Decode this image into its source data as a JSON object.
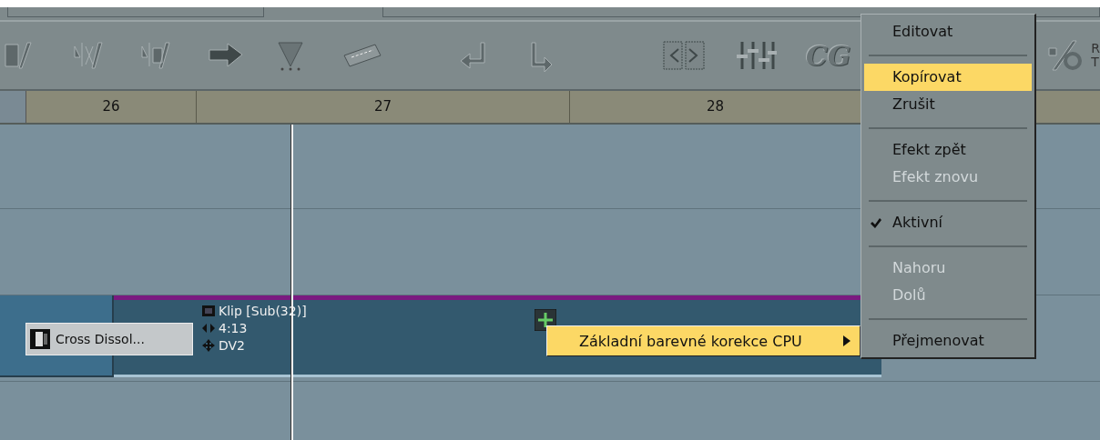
{
  "toolbar": {
    "cg_label": "CG",
    "edge_letters": [
      "R",
      "T"
    ]
  },
  "ruler": {
    "marks": [
      "26",
      "27",
      "28"
    ]
  },
  "timeline": {
    "transition": {
      "label": "Cross Dissol..."
    },
    "clip": {
      "name": "Klip [Sub(32)]",
      "duration": "4:13",
      "format": "DV2"
    }
  },
  "submenu": {
    "label": "Základní barevné korekce CPU",
    "selected": true
  },
  "context_menu": {
    "items": [
      {
        "kind": "item",
        "label": "Editovat",
        "selected": false,
        "disabled": false
      },
      {
        "kind": "separator"
      },
      {
        "kind": "item",
        "label": "Kopírovat",
        "selected": true,
        "disabled": false
      },
      {
        "kind": "item",
        "label": "Zrušit",
        "selected": false,
        "disabled": false
      },
      {
        "kind": "separator"
      },
      {
        "kind": "item",
        "label": "Efekt zpět",
        "selected": false,
        "disabled": false
      },
      {
        "kind": "item",
        "label": "Efekt znovu",
        "selected": false,
        "disabled": true
      },
      {
        "kind": "separator"
      },
      {
        "kind": "item",
        "label": "Aktivní",
        "selected": false,
        "disabled": false,
        "checked": true
      },
      {
        "kind": "separator"
      },
      {
        "kind": "item",
        "label": "Nahoru",
        "selected": false,
        "disabled": true
      },
      {
        "kind": "item",
        "label": "Dolů",
        "selected": false,
        "disabled": true
      },
      {
        "kind": "separator"
      },
      {
        "kind": "item",
        "label": "Přejmenovat",
        "selected": false,
        "disabled": false
      }
    ]
  }
}
